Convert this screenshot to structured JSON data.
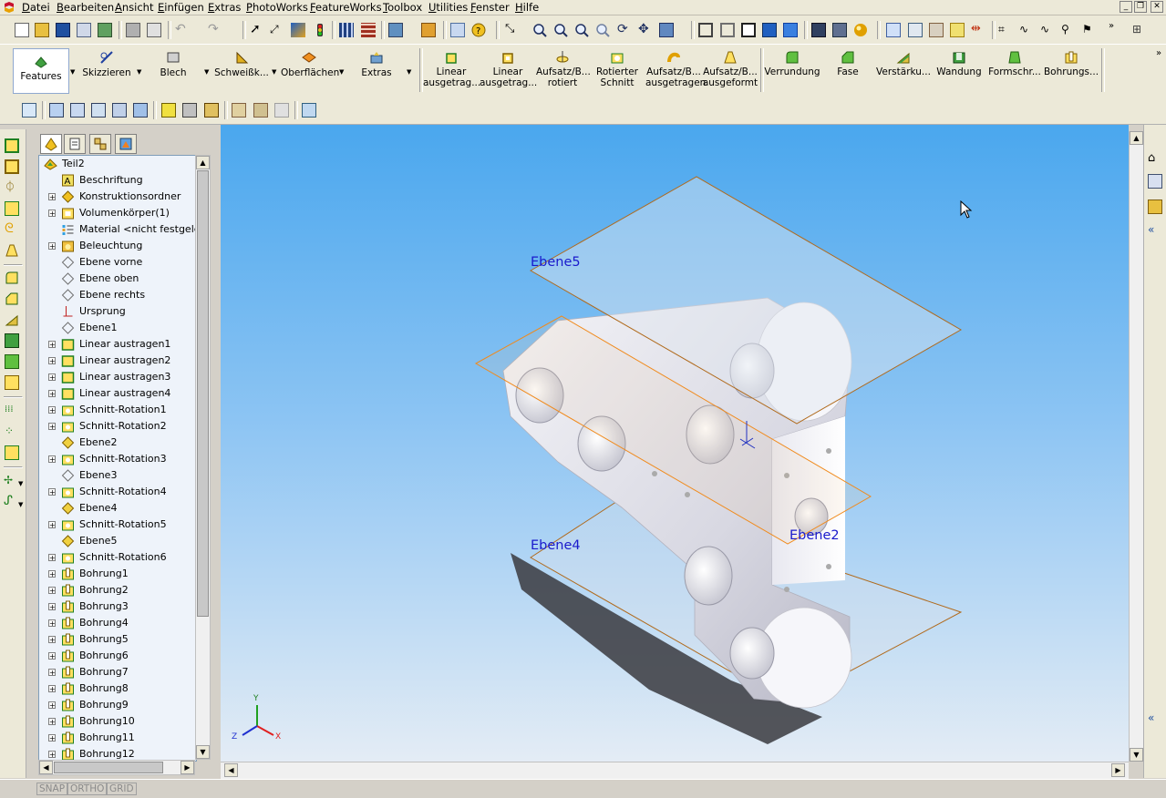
{
  "menubar": {
    "items": [
      "Datei",
      "Bearbeiten",
      "Ansicht",
      "Einfügen",
      "Extras",
      "PhotoWorks",
      "FeatureWorks",
      "Toolbox",
      "Utilities",
      "Fenster",
      "Hilfe"
    ]
  },
  "command_manager": {
    "tabs": [
      {
        "label": "Features"
      },
      {
        "label": "Skizzieren"
      },
      {
        "label": "Blech"
      },
      {
        "label": "Schweißk..."
      },
      {
        "label": "Oberflächen"
      },
      {
        "label": "Extras"
      }
    ],
    "buttons": [
      {
        "line1": "Linear",
        "line2": "ausgetrag..."
      },
      {
        "line1": "Linear",
        "line2": "ausgetrag..."
      },
      {
        "line1": "Aufsatz/B...",
        "line2": "rotiert"
      },
      {
        "line1": "Rotierter",
        "line2": "Schnitt"
      },
      {
        "line1": "Aufsatz/B...",
        "line2": "ausgetragen"
      },
      {
        "line1": "Aufsatz/B...",
        "line2": "ausgeformt"
      },
      {
        "line1": "Verrundung",
        "line2": ""
      },
      {
        "line1": "Fase",
        "line2": ""
      },
      {
        "line1": "Verstärku...",
        "line2": ""
      },
      {
        "line1": "Wandung",
        "line2": ""
      },
      {
        "line1": "Formschr...",
        "line2": ""
      },
      {
        "line1": "Bohrungs...",
        "line2": ""
      }
    ]
  },
  "tree": {
    "root": "Teil2",
    "items": [
      {
        "label": "Beschriftung",
        "expandable": false,
        "icon": "annotation-icon"
      },
      {
        "label": "Konstruktionsordner",
        "expandable": true,
        "icon": "folder-icon"
      },
      {
        "label": "Volumenkörper(1)",
        "expandable": true,
        "icon": "solid-body-icon"
      },
      {
        "label": "Material <nicht festgelegt>",
        "expandable": false,
        "icon": "material-icon"
      },
      {
        "label": "Beleuchtung",
        "expandable": true,
        "icon": "lighting-icon"
      },
      {
        "label": "Ebene vorne",
        "expandable": false,
        "icon": "plane-icon"
      },
      {
        "label": "Ebene oben",
        "expandable": false,
        "icon": "plane-icon"
      },
      {
        "label": "Ebene rechts",
        "expandable": false,
        "icon": "plane-icon"
      },
      {
        "label": "Ursprung",
        "expandable": false,
        "icon": "origin-icon"
      },
      {
        "label": "Ebene1",
        "expandable": false,
        "icon": "plane-icon"
      },
      {
        "label": "Linear austragen1",
        "expandable": true,
        "icon": "extrude-icon"
      },
      {
        "label": "Linear austragen2",
        "expandable": true,
        "icon": "extrude-icon"
      },
      {
        "label": "Linear austragen3",
        "expandable": true,
        "icon": "extrude-icon"
      },
      {
        "label": "Linear austragen4",
        "expandable": true,
        "icon": "extrude-icon"
      },
      {
        "label": "Schnitt-Rotation1",
        "expandable": true,
        "icon": "revolve-cut-icon"
      },
      {
        "label": "Schnitt-Rotation2",
        "expandable": true,
        "icon": "revolve-cut-icon"
      },
      {
        "label": "Ebene2",
        "expandable": false,
        "icon": "plane-active-icon"
      },
      {
        "label": "Schnitt-Rotation3",
        "expandable": true,
        "icon": "revolve-cut-icon"
      },
      {
        "label": "Ebene3",
        "expandable": false,
        "icon": "plane-icon"
      },
      {
        "label": "Schnitt-Rotation4",
        "expandable": true,
        "icon": "revolve-cut-icon"
      },
      {
        "label": "Ebene4",
        "expandable": false,
        "icon": "plane-active-icon"
      },
      {
        "label": "Schnitt-Rotation5",
        "expandable": true,
        "icon": "revolve-cut-icon"
      },
      {
        "label": "Ebene5",
        "expandable": false,
        "icon": "plane-active-icon"
      },
      {
        "label": "Schnitt-Rotation6",
        "expandable": true,
        "icon": "revolve-cut-icon"
      },
      {
        "label": "Bohrung1",
        "expandable": true,
        "icon": "hole-icon"
      },
      {
        "label": "Bohrung2",
        "expandable": true,
        "icon": "hole-icon"
      },
      {
        "label": "Bohrung3",
        "expandable": true,
        "icon": "hole-icon"
      },
      {
        "label": "Bohrung4",
        "expandable": true,
        "icon": "hole-icon"
      },
      {
        "label": "Bohrung5",
        "expandable": true,
        "icon": "hole-icon"
      },
      {
        "label": "Bohrung6",
        "expandable": true,
        "icon": "hole-icon"
      },
      {
        "label": "Bohrung7",
        "expandable": true,
        "icon": "hole-icon"
      },
      {
        "label": "Bohrung8",
        "expandable": true,
        "icon": "hole-icon"
      },
      {
        "label": "Bohrung9",
        "expandable": true,
        "icon": "hole-icon"
      },
      {
        "label": "Bohrung10",
        "expandable": true,
        "icon": "hole-icon"
      },
      {
        "label": "Bohrung11",
        "expandable": true,
        "icon": "hole-icon"
      },
      {
        "label": "Bohrung12",
        "expandable": true,
        "icon": "hole-icon"
      }
    ]
  },
  "viewport": {
    "plane_labels": [
      "Ebene5",
      "Ebene2",
      "Ebene4"
    ],
    "triad": {
      "x": "X",
      "y": "Y",
      "z": "Z"
    }
  },
  "statusbar": {
    "snap": "SNAP",
    "ortho": "ORTHO",
    "grid": "GRID"
  },
  "colors": {
    "accent": "#316ac5",
    "plane_edge": "#b06a1c",
    "plane_selected_edge": "#f08a1c",
    "label_blue": "#1a1acc"
  }
}
